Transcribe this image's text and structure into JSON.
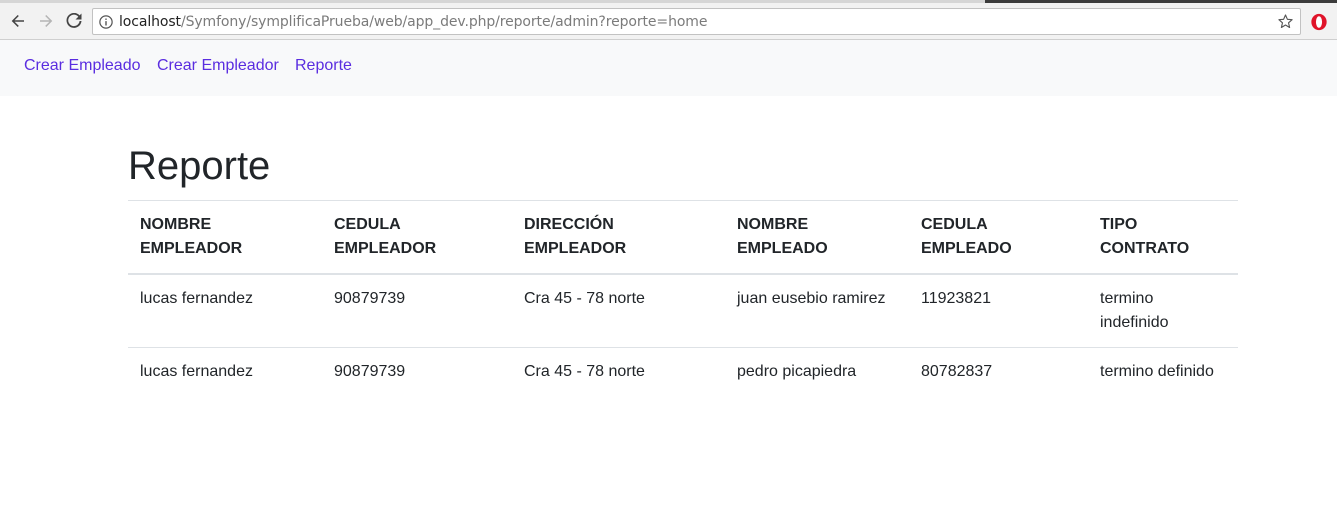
{
  "browser": {
    "url_host": "localhost",
    "url_path": "/Symfony/symplificaPrueba/web/app_dev.php/reporte/admin?reporte=home"
  },
  "navbar": {
    "links": [
      "Crear Empleado",
      "Crear Empleador",
      "Reporte"
    ]
  },
  "page": {
    "title": "Reporte"
  },
  "table": {
    "headers": [
      [
        "NOMBRE",
        "EMPLEADOR"
      ],
      [
        "CEDULA",
        "EMPLEADOR"
      ],
      [
        "DIRECCIÓN",
        "EMPLEADOR"
      ],
      [
        "NOMBRE",
        "EMPLEADO"
      ],
      [
        "CEDULA",
        "EMPLEADO"
      ],
      [
        "TIPO",
        "CONTRATO"
      ]
    ],
    "rows": [
      [
        "lucas fernandez",
        "90879739",
        "Cra 45 - 78 norte",
        "juan eusebio ramirez",
        "11923821",
        "termino indefinido"
      ],
      [
        "lucas fernandez",
        "90879739",
        "Cra 45 - 78 norte",
        "pedro picapiedra",
        "80782837",
        "termino definido"
      ]
    ]
  },
  "colors": {
    "link": "#5a2de0",
    "navbar_bg": "#f8f9fa",
    "text": "#212529",
    "border": "#dee2e6",
    "opera_red": "#e0142a"
  },
  "icons": [
    "back-arrow-icon",
    "forward-arrow-icon",
    "reload-icon",
    "info-icon",
    "star-icon",
    "opera-logo-icon"
  ]
}
